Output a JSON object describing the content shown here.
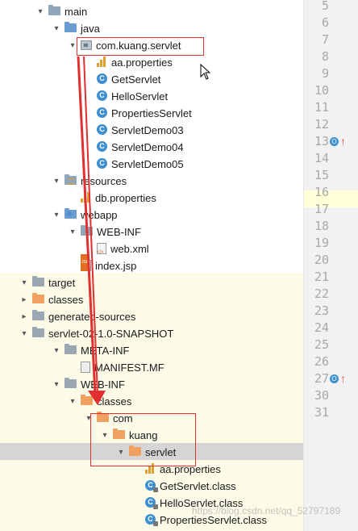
{
  "tree": {
    "rows": [
      {
        "label": "main",
        "icon": "folder-icon",
        "arrow": "▾"
      },
      {
        "label": "java",
        "icon": "folder-icon",
        "arrow": "▾"
      },
      {
        "label": "com.kuang.servlet",
        "icon": "package-icon",
        "arrow": "▾"
      },
      {
        "label": "aa.properties",
        "icon": "properties-file-icon",
        "arrow": ""
      },
      {
        "label": "GetServlet",
        "icon": "class-icon",
        "arrow": ""
      },
      {
        "label": "HelloServlet",
        "icon": "class-icon",
        "arrow": ""
      },
      {
        "label": "PropertiesServlet",
        "icon": "class-icon",
        "arrow": ""
      },
      {
        "label": "ServletDemo03",
        "icon": "class-icon",
        "arrow": ""
      },
      {
        "label": "ServletDemo04",
        "icon": "class-icon",
        "arrow": ""
      },
      {
        "label": "ServletDemo05",
        "icon": "class-icon",
        "arrow": ""
      },
      {
        "label": "resources",
        "icon": "resources-folder-icon",
        "arrow": "▾"
      },
      {
        "label": "db.properties",
        "icon": "properties-file-icon",
        "arrow": ""
      },
      {
        "label": "webapp",
        "icon": "web-folder-icon",
        "arrow": "▾"
      },
      {
        "label": "WEB-INF",
        "icon": "folder-icon",
        "arrow": "▾"
      },
      {
        "label": "web.xml",
        "icon": "xml-file-icon",
        "arrow": ""
      },
      {
        "label": "index.jsp",
        "icon": "jsp-file-icon",
        "arrow": ""
      },
      {
        "label": "target",
        "icon": "folder-icon",
        "arrow": "▾"
      },
      {
        "label": "classes",
        "icon": "folder-icon",
        "arrow": "▸"
      },
      {
        "label": "generated-sources",
        "icon": "folder-icon",
        "arrow": "▸"
      },
      {
        "label": "servlet-02-1.0-SNAPSHOT",
        "icon": "folder-icon",
        "arrow": "▾"
      },
      {
        "label": "META-INF",
        "icon": "folder-icon",
        "arrow": "▾"
      },
      {
        "label": "MANIFEST.MF",
        "icon": "manifest-file-icon",
        "arrow": ""
      },
      {
        "label": "WEB-INF",
        "icon": "folder-icon",
        "arrow": "▾"
      },
      {
        "label": "classes",
        "icon": "folder-icon",
        "arrow": "▾"
      },
      {
        "label": "com",
        "icon": "folder-icon",
        "arrow": "▾"
      },
      {
        "label": "kuang",
        "icon": "folder-icon",
        "arrow": "▾"
      },
      {
        "label": "servlet",
        "icon": "folder-icon",
        "arrow": "▾"
      },
      {
        "label": "aa.properties",
        "icon": "properties-file-icon",
        "arrow": ""
      },
      {
        "label": "GetServlet.class",
        "icon": "class-file-icon",
        "arrow": ""
      },
      {
        "label": "HelloServlet.class",
        "icon": "class-file-icon",
        "arrow": ""
      },
      {
        "label": "PropertiesServlet.class",
        "icon": "class-file-icon",
        "arrow": ""
      }
    ]
  },
  "gutter": {
    "line_numbers": [
      "5",
      "6",
      "7",
      "8",
      "9",
      "10",
      "11",
      "12",
      "13",
      "14",
      "15",
      "16",
      "17",
      "18",
      "19",
      "20",
      "21",
      "22",
      "23",
      "24",
      "25",
      "26",
      "27",
      "30",
      "31"
    ],
    "markers": [
      {
        "line": "13",
        "glyph": "O",
        "arrow": "↑"
      },
      {
        "line": "27",
        "glyph": "O",
        "arrow": "↑"
      }
    ]
  },
  "watermark": "https://blog.csdn.net/qq_52797189",
  "colors": {
    "annotation": "#e03030",
    "selection": "#d5d5d5",
    "excluded_bg": "#fbfbe8",
    "class_icon": "#3d8fd0",
    "output_folder": "#f0a060"
  }
}
